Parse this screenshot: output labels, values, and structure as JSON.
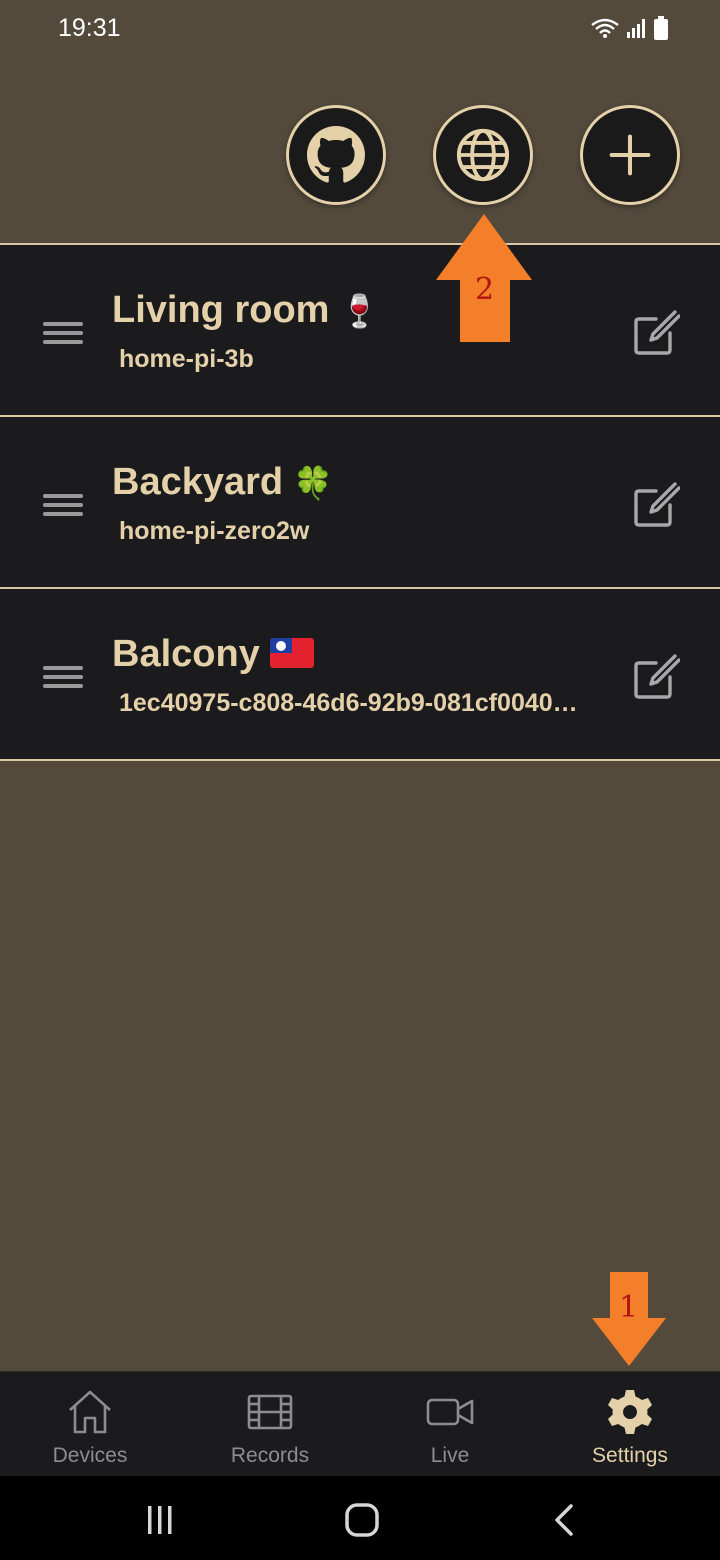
{
  "status": {
    "time": "19:31"
  },
  "devices": [
    {
      "name": "Living room",
      "emoji": "🍷",
      "id": "home-pi-3b"
    },
    {
      "name": "Backyard",
      "emoji": "🍀",
      "id": "home-pi-zero2w"
    },
    {
      "name": "Balcony",
      "flag": "taiwan-flag",
      "id": "1ec40975-c808-46d6-92b9-081cf0040…"
    }
  ],
  "annotations": {
    "one": "1",
    "two": "2"
  },
  "nav": {
    "items": [
      {
        "label": "Devices",
        "icon": "home-icon"
      },
      {
        "label": "Records",
        "icon": "film-icon"
      },
      {
        "label": "Live",
        "icon": "video-icon"
      },
      {
        "label": "Settings",
        "icon": "gear-icon"
      }
    ]
  },
  "colors": {
    "background": "#534a3c",
    "accent": "#e4d1aa",
    "row_bg": "#1b1b1e",
    "annotation_arrow": "#f37f2a",
    "annotation_text": "#b3150e"
  }
}
